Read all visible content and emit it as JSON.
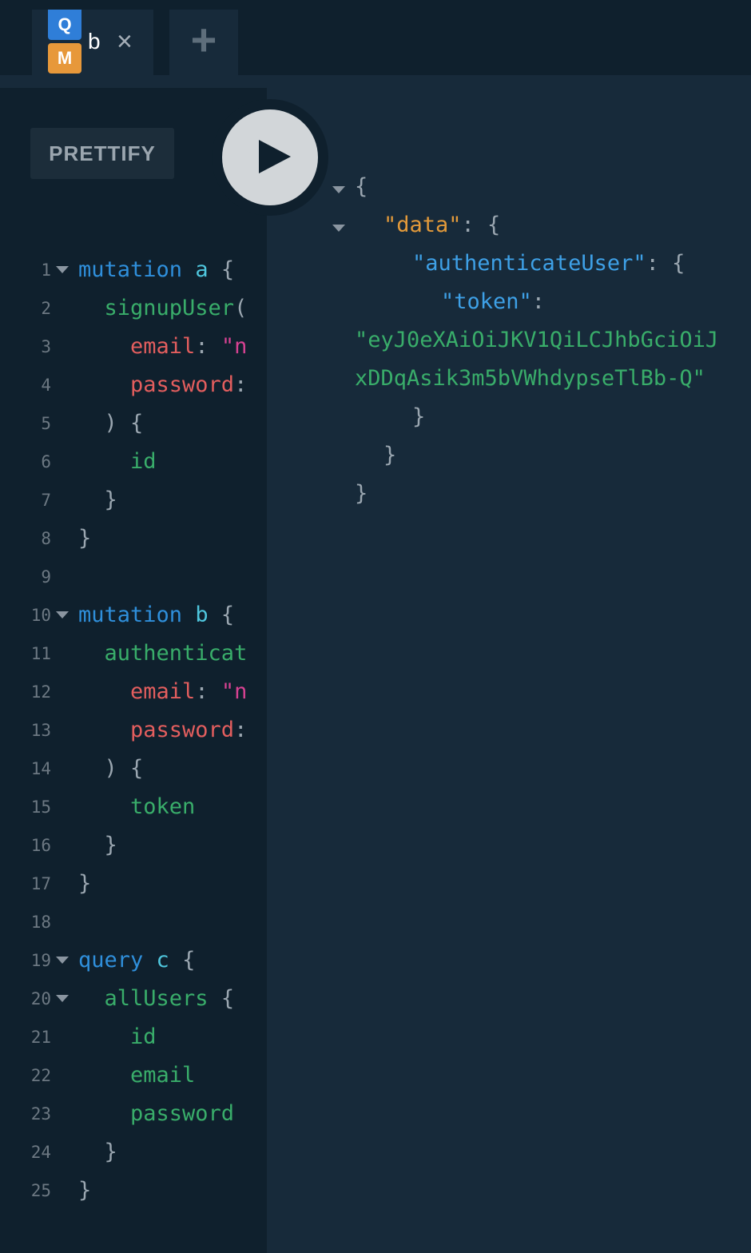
{
  "tabs": [
    {
      "badge_top": "Q",
      "badge_bottom": "M",
      "title": "b",
      "close": "×"
    }
  ],
  "add_tab": "+",
  "toolbar": {
    "prettify_label": "PRETTIFY",
    "run_icon": "play-icon"
  },
  "editor": {
    "lines": [
      {
        "n": "1",
        "fold": true,
        "t": [
          [
            "kw",
            "mutation "
          ],
          [
            "name",
            "a "
          ],
          [
            "punc",
            "{"
          ]
        ]
      },
      {
        "n": "2",
        "fold": false,
        "t": [
          [
            "field",
            "  signupUser"
          ],
          [
            "punc",
            "("
          ]
        ]
      },
      {
        "n": "3",
        "fold": false,
        "t": [
          [
            "arg",
            "    email"
          ],
          [
            "punc",
            ": "
          ],
          [
            "str",
            "\"n"
          ]
        ]
      },
      {
        "n": "4",
        "fold": false,
        "t": [
          [
            "arg",
            "    password"
          ],
          [
            "punc",
            ":"
          ]
        ]
      },
      {
        "n": "5",
        "fold": false,
        "t": [
          [
            "punc",
            "  ) {"
          ]
        ]
      },
      {
        "n": "6",
        "fold": false,
        "t": [
          [
            "field",
            "    id"
          ]
        ]
      },
      {
        "n": "7",
        "fold": false,
        "t": [
          [
            "punc",
            "  }"
          ]
        ]
      },
      {
        "n": "8",
        "fold": false,
        "t": [
          [
            "punc",
            "}"
          ]
        ]
      },
      {
        "n": "9",
        "fold": false,
        "t": []
      },
      {
        "n": "10",
        "fold": true,
        "t": [
          [
            "kw",
            "mutation "
          ],
          [
            "name",
            "b "
          ],
          [
            "punc",
            "{"
          ]
        ]
      },
      {
        "n": "11",
        "fold": false,
        "t": [
          [
            "field",
            "  authenticat"
          ]
        ]
      },
      {
        "n": "12",
        "fold": false,
        "t": [
          [
            "arg",
            "    email"
          ],
          [
            "punc",
            ": "
          ],
          [
            "str",
            "\"n"
          ]
        ]
      },
      {
        "n": "13",
        "fold": false,
        "t": [
          [
            "arg",
            "    password"
          ],
          [
            "punc",
            ":"
          ]
        ]
      },
      {
        "n": "14",
        "fold": false,
        "t": [
          [
            "punc",
            "  ) {"
          ]
        ]
      },
      {
        "n": "15",
        "fold": false,
        "t": [
          [
            "field",
            "    token"
          ]
        ]
      },
      {
        "n": "16",
        "fold": false,
        "t": [
          [
            "punc",
            "  }"
          ]
        ]
      },
      {
        "n": "17",
        "fold": false,
        "t": [
          [
            "punc",
            "}"
          ]
        ]
      },
      {
        "n": "18",
        "fold": false,
        "t": []
      },
      {
        "n": "19",
        "fold": true,
        "t": [
          [
            "kw",
            "query "
          ],
          [
            "name",
            "c "
          ],
          [
            "punc",
            "{"
          ]
        ]
      },
      {
        "n": "20",
        "fold": true,
        "t": [
          [
            "field",
            "  allUsers "
          ],
          [
            "punc",
            "{"
          ]
        ]
      },
      {
        "n": "21",
        "fold": false,
        "t": [
          [
            "field",
            "    id"
          ]
        ]
      },
      {
        "n": "22",
        "fold": false,
        "t": [
          [
            "field",
            "    email"
          ]
        ]
      },
      {
        "n": "23",
        "fold": false,
        "t": [
          [
            "field",
            "    password"
          ]
        ]
      },
      {
        "n": "24",
        "fold": false,
        "t": [
          [
            "punc",
            "  }"
          ]
        ]
      },
      {
        "n": "25",
        "fold": false,
        "t": [
          [
            "punc",
            "}"
          ]
        ]
      }
    ]
  },
  "result": {
    "open_brace": "{",
    "data_key": "\"data\"",
    "colon_brace": ": {",
    "auth_key": "\"authenticateUser\"",
    "token_key": "\"token\"",
    "colon": ":",
    "token_line1": "\"eyJ0eXAiOiJKV1QiLCJhbGciOiJ",
    "token_line2": "xDDqAsik3m5bVWhdypseTlBb-Q\"",
    "close_brace": "}"
  }
}
